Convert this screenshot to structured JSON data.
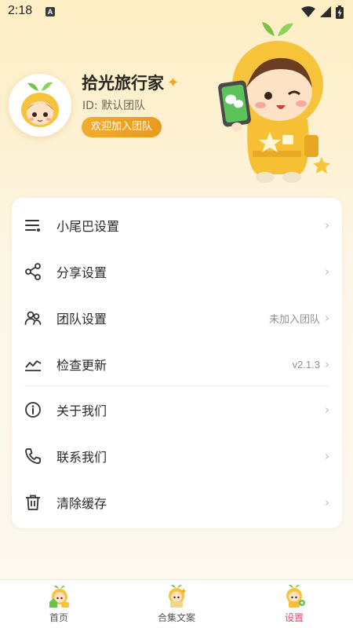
{
  "status_bar": {
    "time": "2:18",
    "notification_icon": "A"
  },
  "profile": {
    "username": "拾光旅行家",
    "team_id": "ID: 默认团队",
    "join_button_label": "欢迎加入团队"
  },
  "settings": {
    "items": [
      {
        "label": "小尾巴设置",
        "value": "",
        "icon": "list-settings-icon"
      },
      {
        "label": "分享设置",
        "value": "",
        "icon": "share-icon"
      },
      {
        "label": "团队设置",
        "value": "未加入团队",
        "icon": "team-icon"
      },
      {
        "label": "检查更新",
        "value": "v2.1.3",
        "icon": "chart-line-icon"
      },
      {
        "label": "关于我们",
        "value": "",
        "icon": "info-icon"
      },
      {
        "label": "联系我们",
        "value": "",
        "icon": "phone-icon"
      },
      {
        "label": "清除缓存",
        "value": "",
        "icon": "trash-icon"
      }
    ]
  },
  "bottom_nav": {
    "items": [
      {
        "label": "首页",
        "active": false
      },
      {
        "label": "合集文案",
        "active": false
      },
      {
        "label": "设置",
        "active": true
      }
    ]
  },
  "colors": {
    "accent": "#f0ad2e",
    "active_tab": "#e2466a",
    "background_top": "#fdeec4"
  }
}
